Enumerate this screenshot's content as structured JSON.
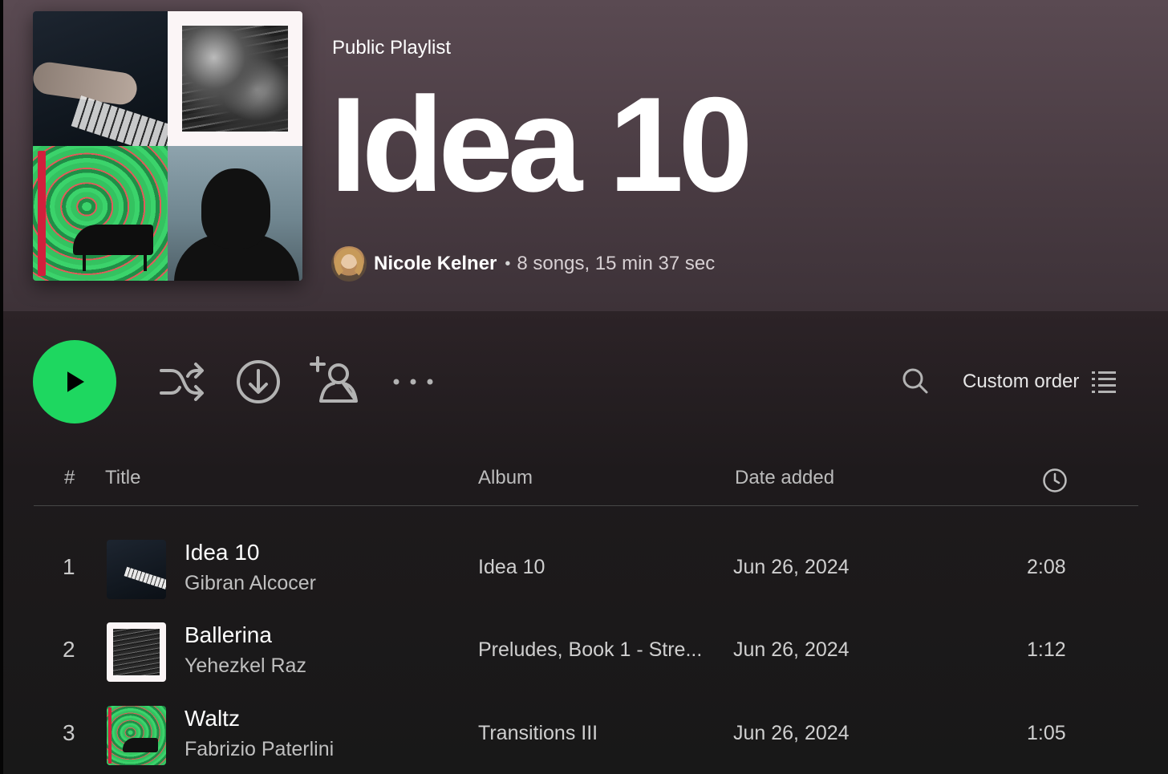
{
  "playlist": {
    "type_label": "Public Playlist",
    "title": "Idea 10",
    "owner": "Nicole Kelner",
    "separator": "•",
    "stats": "8 songs, 15 min 37 sec"
  },
  "actions": {
    "play_icon": "play-icon",
    "shuffle_icon": "shuffle-icon",
    "download_icon": "download-icon",
    "add_user_icon": "add-user-icon",
    "more_icon": "more-icon",
    "search_icon": "search-icon",
    "sort_label": "Custom order",
    "sort_icon": "list-icon"
  },
  "table": {
    "headers": {
      "num": "#",
      "title": "Title",
      "album": "Album",
      "date": "Date added",
      "duration_icon": "clock-icon"
    },
    "rows": [
      {
        "num": "1",
        "title": "Idea 10",
        "artist": "Gibran Alcocer",
        "album": "Idea 10",
        "date": "Jun 26, 2024",
        "duration": "2:08"
      },
      {
        "num": "2",
        "title": "Ballerina",
        "artist": "Yehezkel Raz",
        "album": "Preludes, Book 1 - Stre...",
        "date": "Jun 26, 2024",
        "duration": "1:12"
      },
      {
        "num": "3",
        "title": "Waltz",
        "artist": "Fabrizio Paterlini",
        "album": "Transitions III",
        "date": "Jun 26, 2024",
        "duration": "1:05"
      }
    ]
  },
  "colors": {
    "accent": "#1ed760",
    "header_bg": "#5a4a52",
    "body_bg": "#121212"
  }
}
